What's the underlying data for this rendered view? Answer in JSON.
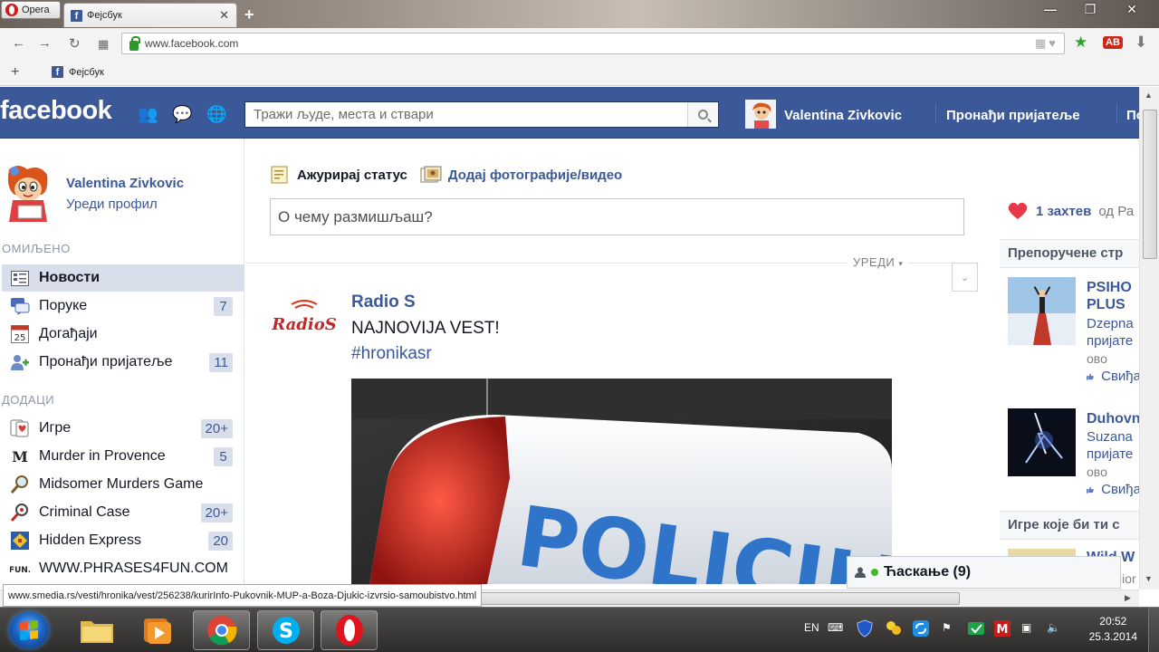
{
  "browser": {
    "menu_label": "Opera",
    "tab_title": "Фејсбук",
    "tab_icon": "facebook-icon",
    "url": "www.facebook.com",
    "bookmark_label": "Фејсбук",
    "status_url": "www.smedia.rs/vesti/hronika/vest/256238/kurirInfo-Pukovnik-MUP-a-Boza-Djukic-izvrsio-samoubistvo.html"
  },
  "topbar": {
    "logo": "facebook",
    "search_placeholder": "Тражи људе, места и ствари",
    "user_name": "Valentina Zivkovic",
    "find_friends": "Пронађи пријатеље",
    "truncated_link": "Почетна"
  },
  "sidebar": {
    "profile_name": "Valentina Zivkovic",
    "edit_profile": "Уреди профил",
    "favorites_title": "ОМИЉЕНО",
    "favorites": [
      {
        "label": "Новости",
        "badge": "",
        "icon": "news-feed-icon"
      },
      {
        "label": "Поруке",
        "badge": "7",
        "icon": "messages-icon"
      },
      {
        "label": "Догађаји",
        "badge": "",
        "icon": "calendar-icon"
      },
      {
        "label": "Пронађи пријатеље",
        "badge": "11",
        "icon": "find-friends-icon"
      }
    ],
    "apps_title": "ДОДАЦИ",
    "apps": [
      {
        "label": "Игре",
        "badge": "20+",
        "icon": "games-icon"
      },
      {
        "label": "Murder in Provence",
        "badge": "5",
        "icon": "murder-in-provence-icon"
      },
      {
        "label": "Midsomer Murders Game",
        "badge": "",
        "icon": "magnifier-icon"
      },
      {
        "label": "Criminal Case",
        "badge": "20+",
        "icon": "criminal-case-icon"
      },
      {
        "label": "Hidden Express",
        "badge": "20",
        "icon": "hidden-express-icon"
      },
      {
        "label": "WWW.PHRASES4FUN.COM",
        "badge": "",
        "icon": "phrases4fun-icon"
      }
    ]
  },
  "composer": {
    "status_tab": "Ажурирај статус",
    "photo_tab": "Додај фотографије/видео",
    "placeholder": "О чему размишљаш?"
  },
  "feed": {
    "edit_label": "УРЕДИ",
    "post": {
      "author": "Radio S",
      "logo_text": "RadioS",
      "text": "NAJNOVIJA VEST!",
      "hashtag": "#hronikasr",
      "image_text": "POLICIJA"
    }
  },
  "right": {
    "request_count": "1 захтев",
    "request_rest": "од Ра",
    "suggested_title": "Препоручене стр",
    "pages": [
      {
        "title1": "PSIHO",
        "title2": "PLUS",
        "line1": "Dzepna",
        "line2": "пријате",
        "line3": "ово",
        "like": "Свиђа"
      },
      {
        "title1": "Duhovn",
        "title2": "",
        "line1": "Suzana",
        "line2": "пријате",
        "line3": "ово",
        "like": "Свиђа"
      }
    ],
    "games_title": "Игре које би ти с",
    "games_partial": "Wild W",
    "games_partial2": "lior"
  },
  "chat": {
    "label": "Ћаскање (9)"
  },
  "taskbar": {
    "lang": "EN",
    "time": "20:52",
    "date": "25.3.2014"
  }
}
